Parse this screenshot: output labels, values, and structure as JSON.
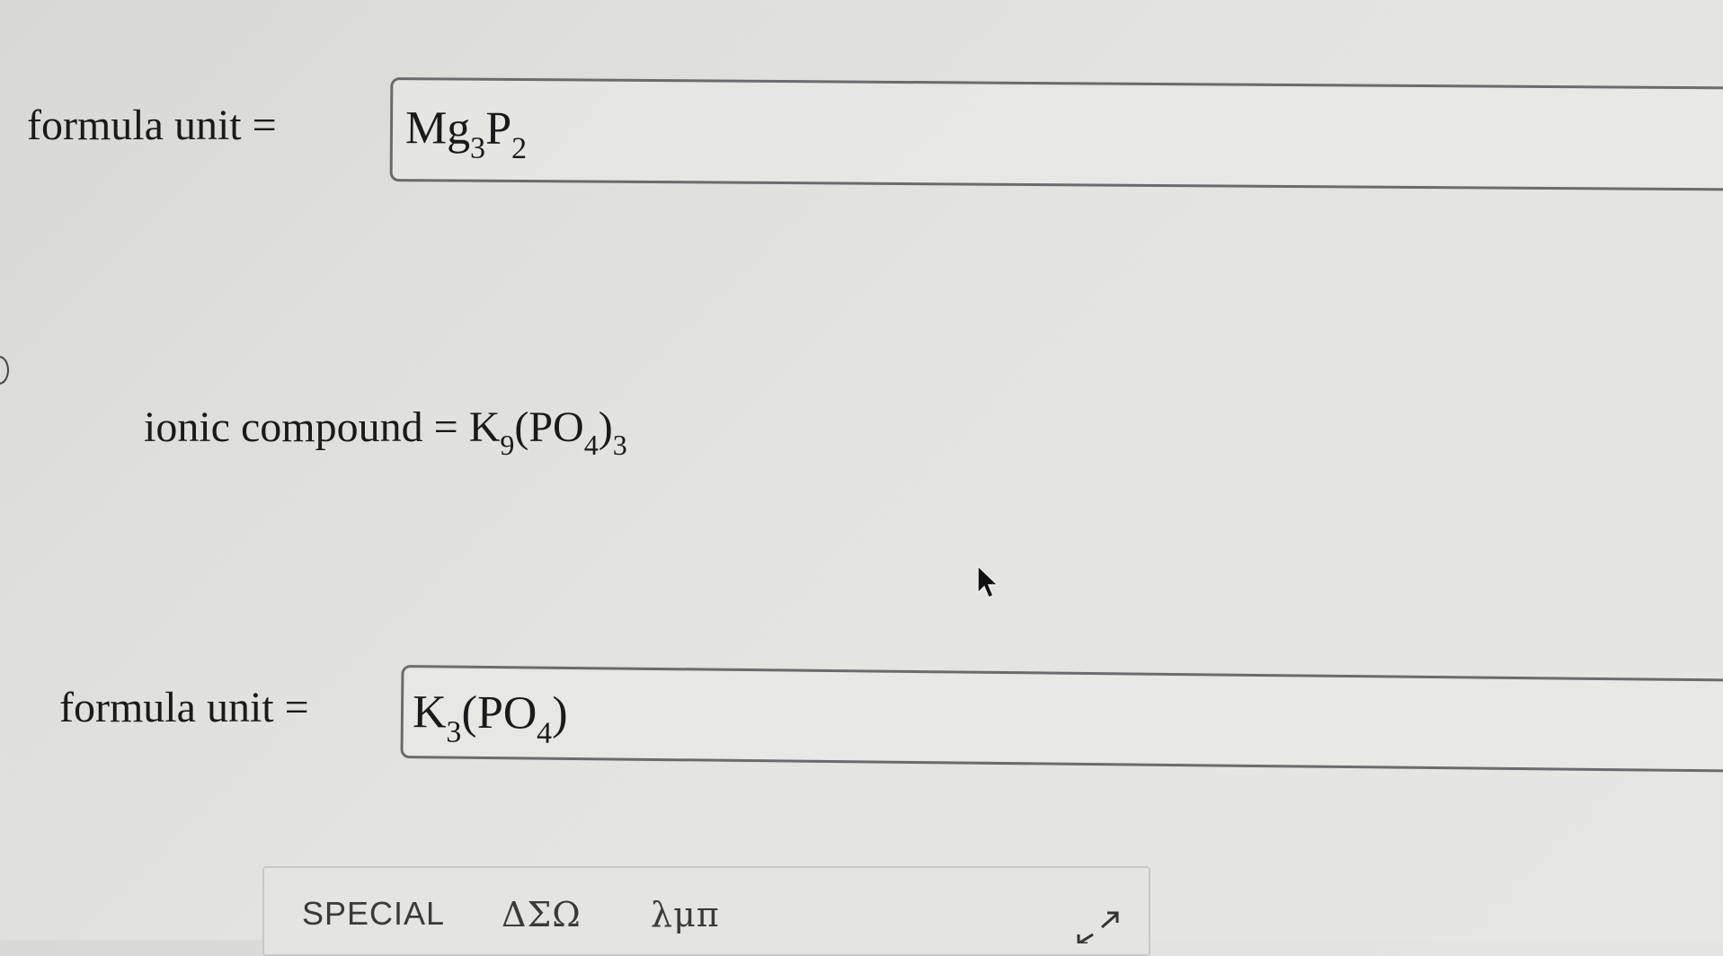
{
  "rows": [
    {
      "label": "formula unit =",
      "answer": {
        "parts": [
          "Mg",
          "3",
          "P",
          "2"
        ]
      }
    },
    {
      "ionic_label": "ionic compound =",
      "formula_parts": [
        "K",
        "9",
        "(PO",
        "4",
        ")",
        "3"
      ]
    },
    {
      "label": "formula unit =",
      "answer": {
        "parts": [
          "K",
          "3",
          "(PO",
          "4",
          ")"
        ]
      }
    }
  ],
  "toolbar": {
    "tabs": [
      {
        "label": "SPECIAL"
      },
      {
        "label": "ΔΣΩ"
      },
      {
        "label": "λμπ"
      }
    ],
    "expand_icon": "expand-arrow-icon"
  },
  "cursor_icon": "mouse-pointer-icon"
}
